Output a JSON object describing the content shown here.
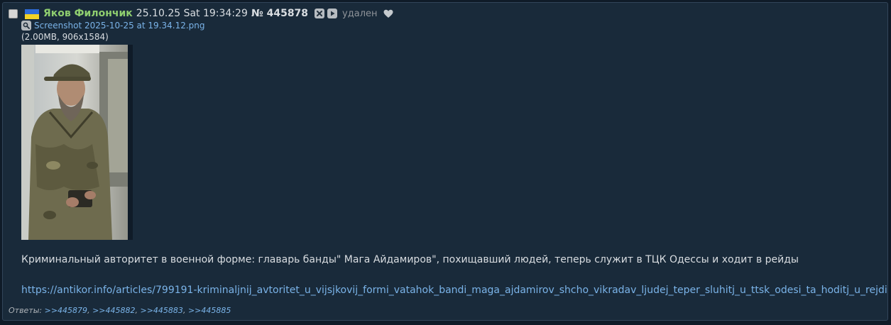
{
  "post": {
    "author": "Яков Филончик",
    "datetime": "25.10.25 Sat 19:34:29",
    "number_label": "№ 445878",
    "deleted_label": "удален",
    "flag_colors": [
      "#2d6ad8",
      "#f2d228"
    ],
    "icons": [
      "checkbox",
      "flag-icon",
      "hide-icon",
      "play-icon",
      "heart-icon",
      "magnifier-icon"
    ]
  },
  "file": {
    "name": "Screenshot 2025-10-25 at 19.34.12.png",
    "meta": "(2.00MB, 906x1584)"
  },
  "message": {
    "text": "Криминальный авторитет в военной форме: главарь банды\" Мага Айдамиров\", похищавший людей, теперь служит в ТЦК Одессы и ходит в рейды",
    "link": "https://antikor.info/articles/799191-kriminaljnij_avtoritet_u_vijsjkovij_formi_vatahok_bandi_maga_ajdamirov_shcho_vikradav_ljudej_teper_sluhitj_u_ttsk_odesi_ta_hoditj_u_rejdi"
  },
  "replies": {
    "label": "Ответы:",
    "links": [
      ">>445879",
      ">>445882",
      ">>445883",
      ">>445885"
    ]
  }
}
